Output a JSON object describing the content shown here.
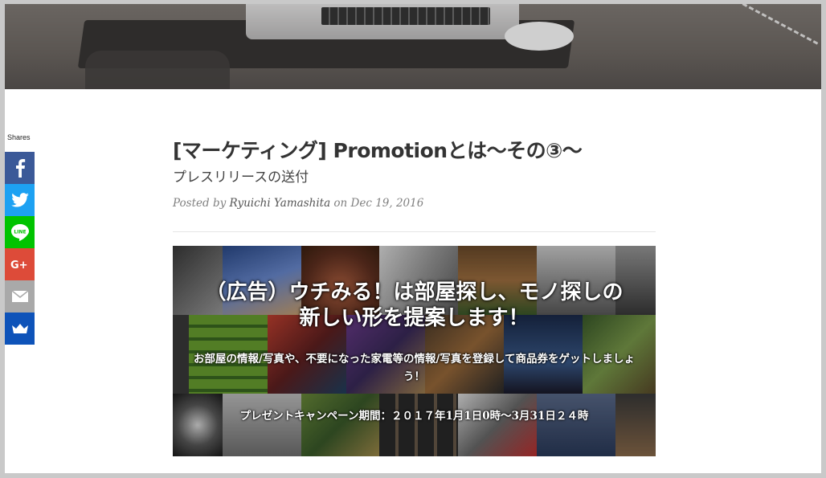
{
  "shares": {
    "label": "Shares",
    "buttons": [
      {
        "name": "facebook",
        "icon": "facebook-icon",
        "color": "#3b5998"
      },
      {
        "name": "twitter",
        "icon": "twitter-icon",
        "color": "#1da1f2"
      },
      {
        "name": "line",
        "icon": "line-icon",
        "color": "#00c300"
      },
      {
        "name": "googleplus",
        "icon": "google-plus-icon",
        "color": "#dd4b39"
      },
      {
        "name": "email",
        "icon": "email-icon",
        "color": "#a9a9a9"
      },
      {
        "name": "sumome",
        "icon": "crown-icon",
        "color": "#0e53b9"
      }
    ]
  },
  "post": {
    "title": "[マーケティング] Promotionとは〜その③〜",
    "subtitle": "プレスリリースの送付",
    "meta": {
      "posted_by": "Posted by",
      "author": "Ryuichi Yamashita",
      "on": "on",
      "date": "Dec 19, 2016"
    }
  },
  "banner": {
    "headline_line1": "（広告）ウチみる！は部屋探し、モノ探しの",
    "headline_line2": "新しい形を提案します！",
    "sub_line1": "お部屋の情報/写真や、不要になった家電等の情報/写真を登録して商品券をゲットしましょ",
    "sub_line2": "う！",
    "campaign": "プレゼントキャンペーン期間：２０１７年1月1日0時〜3月31日２４時"
  }
}
